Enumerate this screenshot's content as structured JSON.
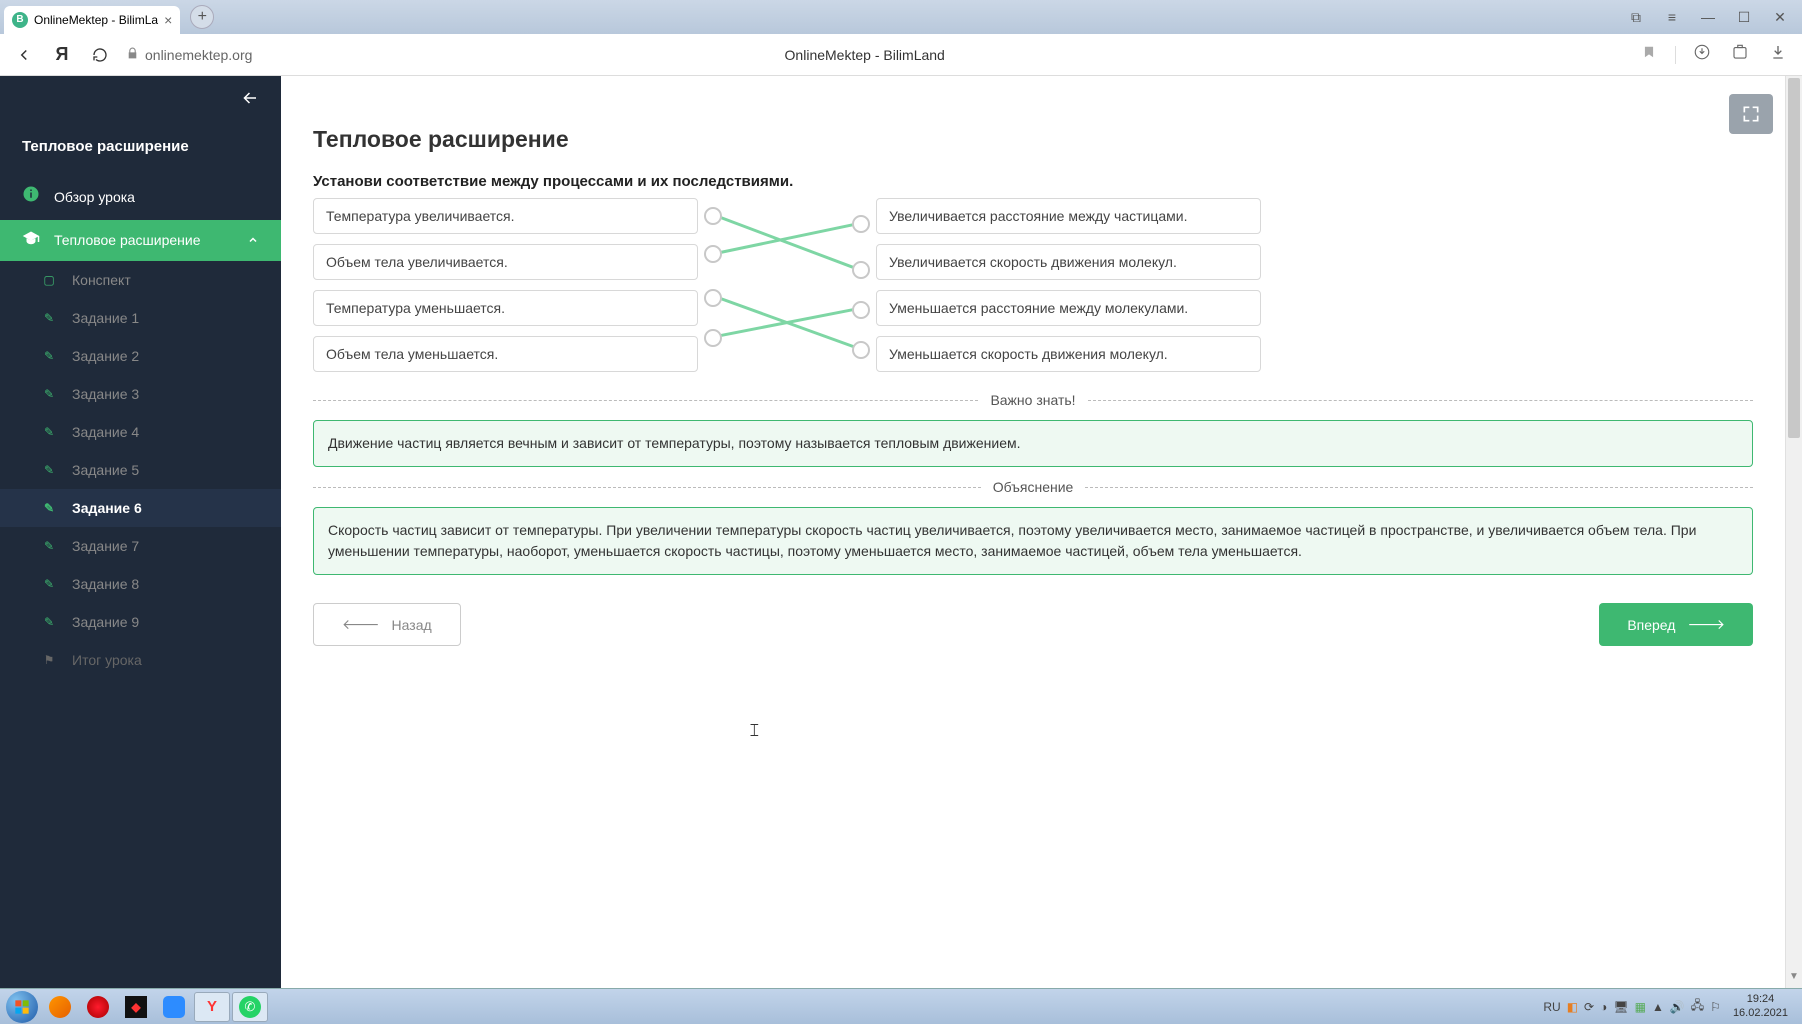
{
  "browser": {
    "tab_title": "OnlineMektep - BilimLa",
    "url": "onlinemektep.org",
    "page_title": "OnlineMektep - BilimLand"
  },
  "sidebar": {
    "title": "Тепловое расширение",
    "overview": "Обзор урока",
    "section": "Тепловое расширение",
    "items": [
      {
        "label": "Конспект"
      },
      {
        "label": "Задание 1"
      },
      {
        "label": "Задание 2"
      },
      {
        "label": "Задание 3"
      },
      {
        "label": "Задание 4"
      },
      {
        "label": "Задание 5"
      },
      {
        "label": "Задание 6"
      },
      {
        "label": "Задание 7"
      },
      {
        "label": "Задание 8"
      },
      {
        "label": "Задание 9"
      }
    ],
    "summary": "Итог урока"
  },
  "lesson": {
    "title": "Тепловое расширение",
    "instruction": "Установи соответствие между процессами и их последствиями.",
    "left": [
      "Температура увеличивается.",
      "Объем тела увеличивается.",
      "Температура уменьшается.",
      "Объем тела уменьшается."
    ],
    "right": [
      "Увеличивается расстояние между частицами.",
      "Увеличивается скорость движения молекул.",
      "Уменьшается расстояние между молекулами.",
      "Уменьшается скорость движения молекул."
    ],
    "important_label": "Важно знать!",
    "important_text": "Движение частиц является вечным и зависит от температуры, поэтому называется тепловым движением.",
    "explain_label": "Объяснение",
    "explain_text": "Скорость частиц зависит от температуры. При увеличении температуры скорость частиц увеличивается, поэтому увеличивается место, занимаемое частицей в пространстве, и увеличивается объем тела. При уменьшении температуры, наоборот, уменьшается скорость частицы, поэтому уменьшается место, занимаемое частицей, объем тела уменьшается.",
    "back_btn": "Назад",
    "next_btn": "Вперед"
  },
  "taskbar": {
    "lang": "RU",
    "time": "19:24",
    "date": "16.02.2021"
  }
}
